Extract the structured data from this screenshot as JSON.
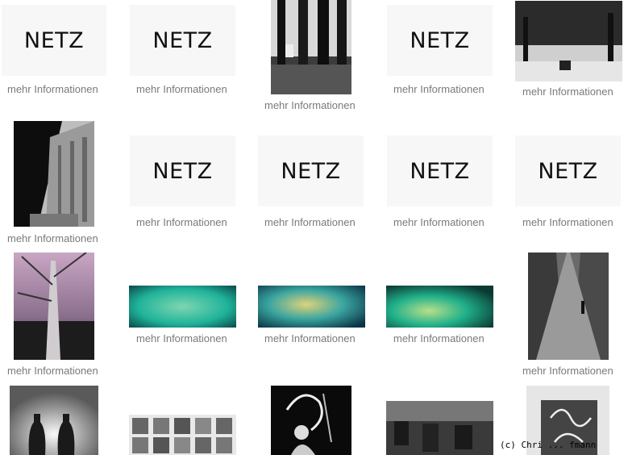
{
  "logo_text": "NETZ",
  "caption": "mehr Informationen",
  "copyright": "(c) Chri   ... fmann",
  "colors": {
    "caption": "#7a7a7a",
    "netz_bg": "#f7f7f7",
    "water": "#1fb39a"
  },
  "rows": [
    [
      "netz",
      "park-dog-trees",
      "netz",
      "netz",
      "park-chair"
    ],
    [
      "colonnade",
      "netz",
      "netz",
      "netz",
      "netz"
    ],
    [
      "tree-pink-sky",
      "water-green-1",
      "water-green-2",
      "water-green-3",
      "bridge-walker"
    ],
    [
      "vases",
      "portrait-grid",
      "abstract-figure",
      "street-group",
      "pattern-flowers"
    ]
  ]
}
